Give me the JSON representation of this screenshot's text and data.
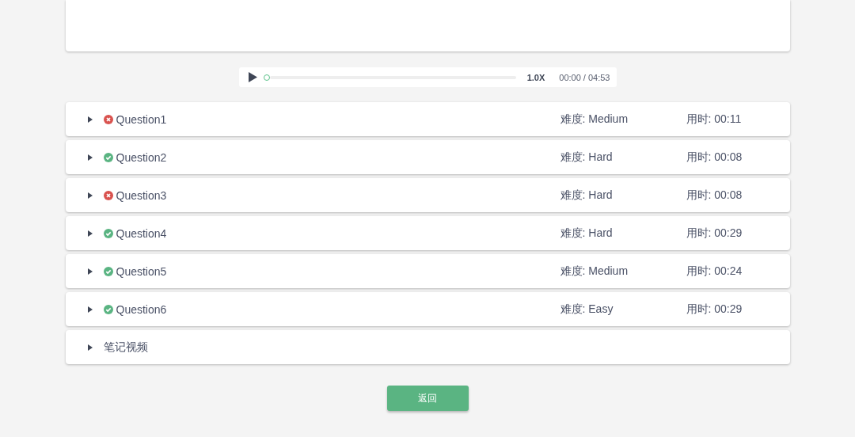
{
  "player": {
    "level": 0,
    "speed": "1.0X",
    "time": "00:00 / 04:53"
  },
  "questions": [
    {
      "title": "Question1",
      "correct": false,
      "expanded": false,
      "difficulty": "难度: Medium",
      "duration": "用时: 00:11"
    },
    {
      "title": "Question2",
      "correct": true,
      "expanded": false,
      "difficulty": "难度: Hard",
      "duration": "用时: 00:08"
    },
    {
      "title": "Question3",
      "correct": false,
      "expanded": false,
      "difficulty": "难度: Hard",
      "duration": "用时: 00:08"
    },
    {
      "title": "Question4",
      "correct": true,
      "expanded": false,
      "difficulty": "难度: Hard",
      "duration": "用时: 00:29"
    },
    {
      "title": "Question5",
      "correct": true,
      "expanded": false,
      "difficulty": "难度: Medium",
      "duration": "用时: 00:24"
    },
    {
      "title": "Question6",
      "correct": true,
      "expanded": false,
      "difficulty": "难度: Easy",
      "duration": "用时: 00:29"
    }
  ],
  "notes": {
    "title": "笔记视频",
    "expanded": false
  },
  "back_button": "返回"
}
